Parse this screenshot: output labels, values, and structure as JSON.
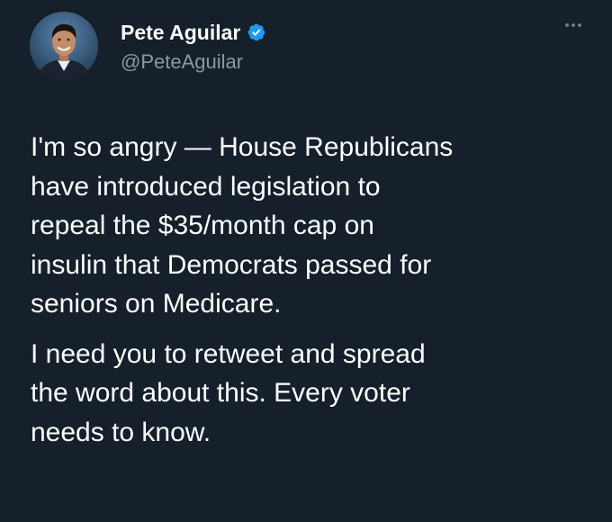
{
  "tweet": {
    "author": {
      "display_name": "Pete Aguilar",
      "handle": "@PeteAguilar",
      "verified": true,
      "avatar_icon": "profile-photo"
    },
    "more_icon": "ellipsis-icon",
    "paragraphs": [
      "I'm so angry — House Republicans\nhave introduced legislation to\nrepeal the $35/month cap on\ninsulin that Democrats passed for\nseniors on Medicare.",
      "I need you to retweet and spread\nthe word about this. Every voter\nneeds to know."
    ]
  },
  "colors": {
    "background": "#15202b",
    "text": "#ffffff",
    "secondary_text": "#8b98a5",
    "verified_badge": "#1d9bf0"
  }
}
